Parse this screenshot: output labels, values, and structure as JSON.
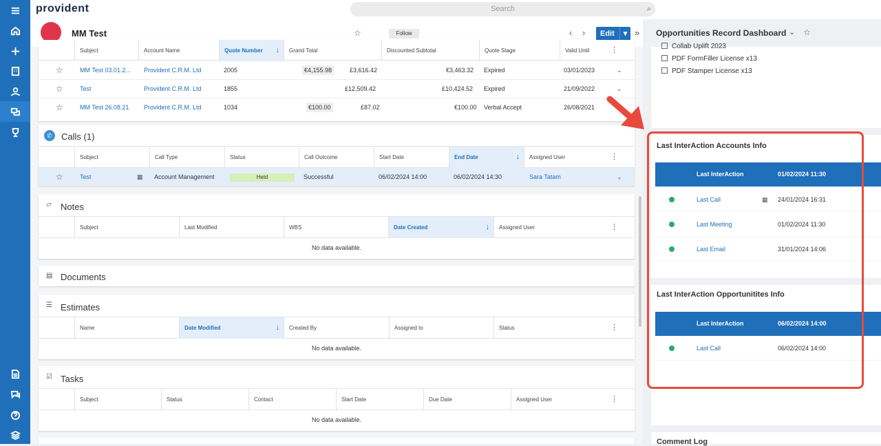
{
  "app": {
    "logo": "provident",
    "search_placeholder": "Search"
  },
  "record": {
    "title": "MM Test",
    "follow_label": "Follow",
    "edit_label": "Edit"
  },
  "quotes": {
    "columns": [
      "Subject",
      "Account Name",
      "Quote Number",
      "Grand Total",
      "Discounted Subtotal",
      "Quote Stage",
      "Valid Until"
    ],
    "rows": [
      {
        "subject": "MM Test 03.01.2...",
        "account": "Provident C.R.M. Ltd",
        "number": "2005",
        "chip": "€4,155.98",
        "grand": "£3,616.42",
        "disc": "€3,463.32",
        "stage": "Expired",
        "valid": "03/01/2023"
      },
      {
        "subject": "Test",
        "account": "Provident C.R.M. Ltd",
        "number": "1855",
        "chip": "",
        "grand": "£12,509.42",
        "disc": "£10,424.52",
        "stage": "Expired",
        "valid": "21/09/2022"
      },
      {
        "subject": "MM Test 26.08.21",
        "account": "Provident C.R.M. Ltd",
        "number": "1034",
        "chip": "€100.00",
        "grand": "£87.02",
        "disc": "€100.00",
        "stage": "Verbal Accept",
        "valid": "26/08/2021"
      }
    ]
  },
  "calls": {
    "title": "Calls (1)",
    "columns": [
      "Subject",
      "Call Type",
      "Status",
      "Call Outcome",
      "Start Date",
      "End Date",
      "Assigned User"
    ],
    "row": {
      "subject": "Test",
      "type": "Account Management",
      "status": "Held",
      "outcome": "Successful",
      "start": "06/02/2024 14:00",
      "end": "06/02/2024 14:30",
      "user": "Sara Tatam"
    }
  },
  "notes": {
    "title": "Notes",
    "columns": [
      "Subject",
      "Last Modified",
      "WBS",
      "Date Created",
      "Assigned User"
    ],
    "empty": "No data available."
  },
  "documents": {
    "title": "Documents"
  },
  "estimates": {
    "title": "Estimates",
    "columns": [
      "Name",
      "Date Modified",
      "Created By",
      "Assigned to",
      "Status"
    ],
    "empty": "No data available."
  },
  "tasks": {
    "title": "Tasks",
    "columns": [
      "Subject",
      "Status",
      "Contact",
      "Start Date",
      "Due Date",
      "Assigned User"
    ],
    "empty": "No data available."
  },
  "dashboard": {
    "title": "Opportunities Record Dashboard",
    "licenses": [
      "Collab Uplift 2023",
      "PDF FormFiller License x13",
      "PDF Stamper License x13"
    ],
    "accounts": {
      "title": "Last InterAction Accounts Info",
      "header_label": "Last InterAction",
      "header_date": "01/02/2024 11:30",
      "items": [
        {
          "label": "Last Call",
          "date": "24/01/2024 16:31"
        },
        {
          "label": "Last Meeting",
          "date": "01/02/2024 11:30"
        },
        {
          "label": "Last Email",
          "date": "31/01/2024 14:06"
        }
      ]
    },
    "opps": {
      "title": "Last InterAction Opportunitites Info",
      "header_label": "Last InterAction",
      "header_date": "06/02/2024 14:00",
      "items": [
        {
          "label": "Last Call",
          "date": "06/02/2024 14:00"
        }
      ]
    },
    "comment_log": "Comment Log"
  }
}
